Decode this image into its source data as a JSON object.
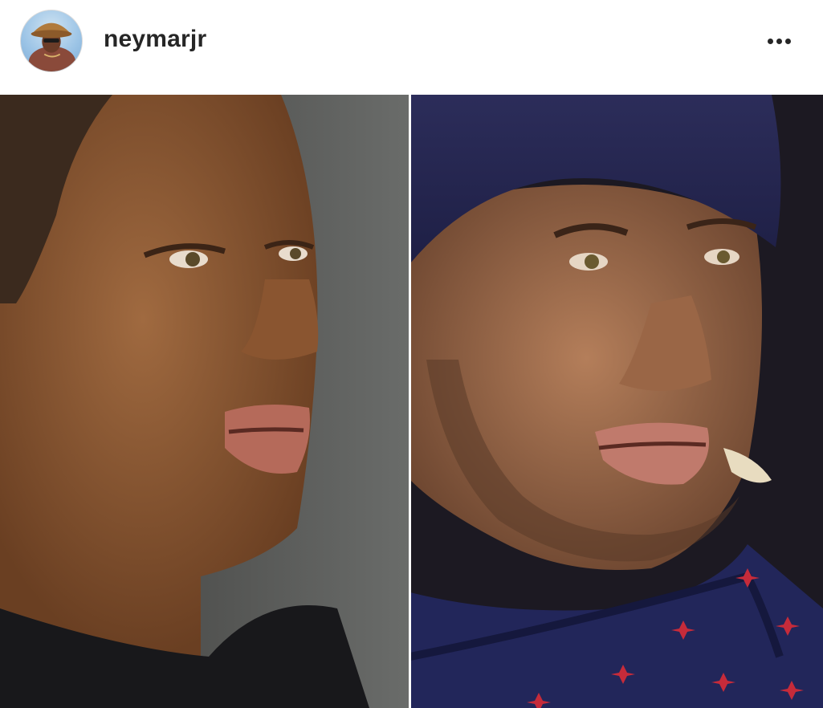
{
  "post": {
    "username": "neymarjr",
    "avatar_icon": "profile-avatar",
    "more_icon": "more-horizontal-icon"
  },
  "colors": {
    "text": "#262626",
    "background": "#ffffff"
  }
}
